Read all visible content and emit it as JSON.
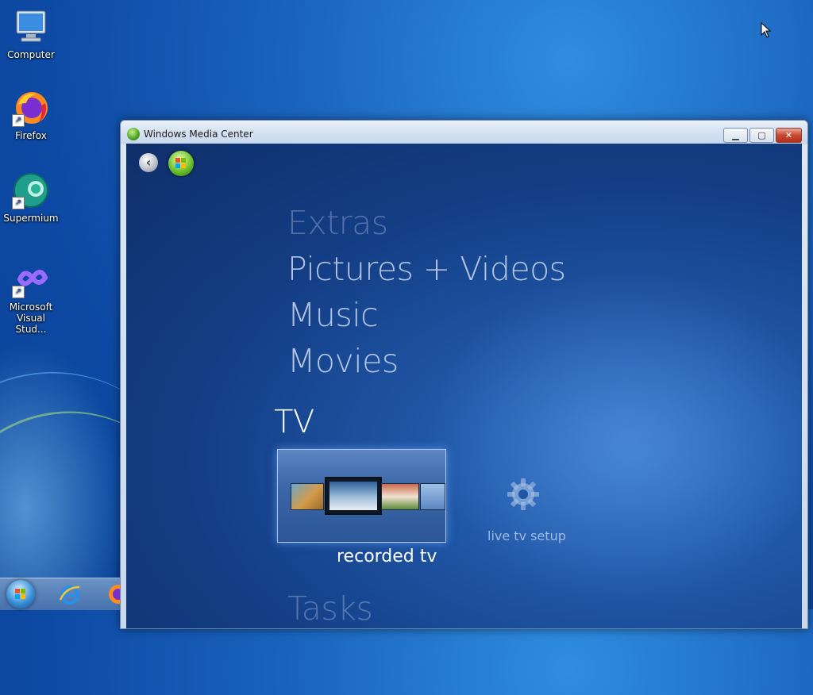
{
  "desktop": {
    "icons": [
      {
        "label": "Computer",
        "icon": "computer-icon"
      },
      {
        "label": "Firefox",
        "icon": "firefox-icon"
      },
      {
        "label": "Supermium",
        "icon": "supermium-icon"
      },
      {
        "label": "Microsoft Visual Stud...",
        "icon": "visual-studio-icon"
      }
    ]
  },
  "window": {
    "title": "Windows Media Center",
    "controls": {
      "minimize": "minimize-icon",
      "maximize": "maximize-icon",
      "close": "close-icon"
    }
  },
  "media_center": {
    "menu": {
      "extras": "Extras",
      "pictures": "Pictures + Videos",
      "music": "Music",
      "movies": "Movies",
      "tv": "TV",
      "tasks": "Tasks"
    },
    "tv_items": {
      "recorded": "recorded tv",
      "live_setup": "live tv setup"
    }
  },
  "taskbar": {
    "items": [
      "start-orb",
      "internet-explorer-icon",
      "firefox-icon"
    ]
  },
  "colors": {
    "desktop_bg": "#1a63bd",
    "media_center_bg": "#143f86",
    "selected_text": "#ffffff"
  }
}
